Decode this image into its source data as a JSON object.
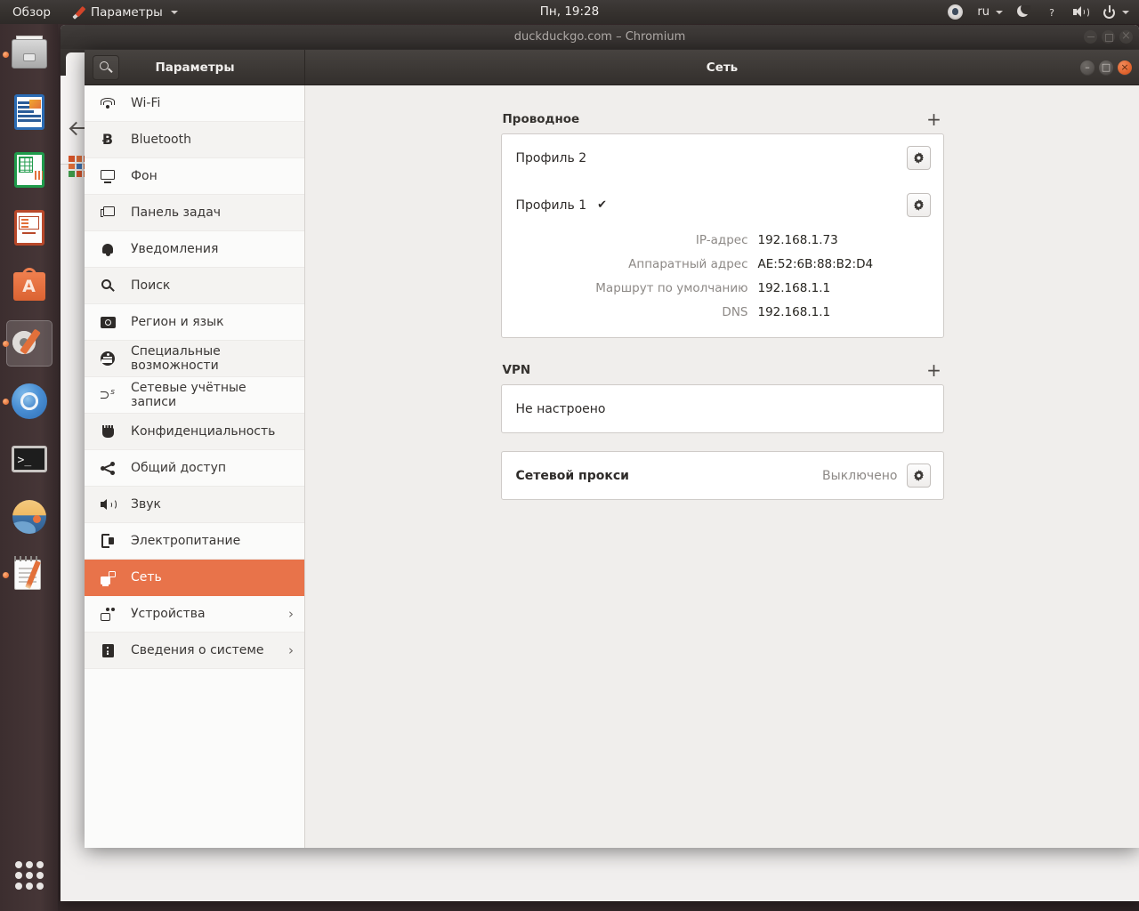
{
  "top_panel": {
    "overview_label": "Обзор",
    "app_menu_label": "Параметры",
    "app_menu_icon": "settings-wrench-icon",
    "clock": "Пн, 19:28",
    "tray": [
      {
        "name": "notification-indicator-icon",
        "icon": "circle-eye-icon",
        "label": ""
      },
      {
        "name": "keyboard-layout-indicator",
        "icon": "",
        "label": "ru"
      },
      {
        "name": "night-light-indicator-icon",
        "icon": "moon-icon",
        "label": ""
      },
      {
        "name": "help-indicator-icon",
        "icon": "keyboard-question-icon",
        "label": ""
      },
      {
        "name": "volume-indicator-icon",
        "icon": "speaker-icon",
        "label": ""
      },
      {
        "name": "system-menu-icon",
        "icon": "power-icon",
        "label": ""
      }
    ]
  },
  "launcher": {
    "items": [
      {
        "name": "launcher-item-files",
        "icon": "files-icon",
        "running": true,
        "active": false
      },
      {
        "name": "launcher-item-libreoffice-writer",
        "icon": "writer-icon",
        "running": false,
        "active": false
      },
      {
        "name": "launcher-item-libreoffice-calc",
        "icon": "calc-icon",
        "running": false,
        "active": false
      },
      {
        "name": "launcher-item-libreoffice-impress",
        "icon": "impress-icon",
        "running": false,
        "active": false
      },
      {
        "name": "launcher-item-ubuntu-software",
        "icon": "software-icon",
        "running": false,
        "active": false
      },
      {
        "name": "launcher-item-settings",
        "icon": "settings-icon",
        "running": true,
        "active": true
      },
      {
        "name": "launcher-item-chromium",
        "icon": "chromium-icon",
        "running": true,
        "active": false
      },
      {
        "name": "launcher-item-terminal",
        "icon": "terminal-icon",
        "running": false,
        "active": false
      },
      {
        "name": "launcher-item-photos",
        "icon": "photos-icon",
        "running": false,
        "active": false
      },
      {
        "name": "launcher-item-text-editor",
        "icon": "editor-icon",
        "running": true,
        "active": false
      }
    ],
    "app_grid_name": "show-applications-button"
  },
  "chromium_window": {
    "title": "duckduckgo.com – Chromium",
    "back_icon": "back-arrow-icon",
    "apps_icon": "apps-grid-icon",
    "controls": {
      "minimize": "–",
      "maximize": "□",
      "close": "×"
    }
  },
  "settings_window": {
    "sidebar_header_title": "Параметры",
    "search_icon": "search-icon",
    "main_header_title": "Сеть",
    "controls": {
      "minimize": "–",
      "maximize": "□",
      "close": "×"
    }
  },
  "sidebar": {
    "items": [
      {
        "label": "Wi-Fi",
        "icon": "wifi-icon",
        "name": "sidebar-item-wifi",
        "selected": false,
        "chevron": false
      },
      {
        "label": "Bluetooth",
        "icon": "bluetooth-icon",
        "name": "sidebar-item-bluetooth",
        "selected": false,
        "chevron": false
      },
      {
        "label": "Фон",
        "icon": "background-icon",
        "name": "sidebar-item-background",
        "selected": false,
        "chevron": false
      },
      {
        "label": "Панель задач",
        "icon": "dock-icon",
        "name": "sidebar-item-dock",
        "selected": false,
        "chevron": false
      },
      {
        "label": "Уведомления",
        "icon": "bell-icon",
        "name": "sidebar-item-notifications",
        "selected": false,
        "chevron": false
      },
      {
        "label": "Поиск",
        "icon": "magnifier-icon",
        "name": "sidebar-item-search",
        "selected": false,
        "chevron": false
      },
      {
        "label": "Регион и язык",
        "icon": "region-icon",
        "name": "sidebar-item-region-language",
        "selected": false,
        "chevron": false
      },
      {
        "label": "Специальные возможности",
        "icon": "accessibility-icon",
        "name": "sidebar-item-accessibility",
        "selected": false,
        "chevron": false
      },
      {
        "label": "Сетевые учётные записи",
        "icon": "online-accounts-icon",
        "name": "sidebar-item-online-accounts",
        "selected": false,
        "chevron": false
      },
      {
        "label": "Конфиденциальность",
        "icon": "hand-privacy-icon",
        "name": "sidebar-item-privacy",
        "selected": false,
        "chevron": false
      },
      {
        "label": "Общий доступ",
        "icon": "share-icon",
        "name": "sidebar-item-sharing",
        "selected": false,
        "chevron": false
      },
      {
        "label": "Звук",
        "icon": "speaker-icon",
        "name": "sidebar-item-sound",
        "selected": false,
        "chevron": false
      },
      {
        "label": "Электропитание",
        "icon": "power-plug-icon",
        "name": "sidebar-item-power",
        "selected": false,
        "chevron": false
      },
      {
        "label": "Сеть",
        "icon": "network-icon",
        "name": "sidebar-item-network",
        "selected": true,
        "chevron": false
      },
      {
        "label": "Устройства",
        "icon": "devices-icon",
        "name": "sidebar-item-devices",
        "selected": false,
        "chevron": true
      },
      {
        "label": "Сведения о системе",
        "icon": "info-icon",
        "name": "sidebar-item-details",
        "selected": false,
        "chevron": true
      }
    ],
    "chevron_glyph": "›"
  },
  "network_page": {
    "wired": {
      "title": "Проводное",
      "add_label": "+",
      "profiles": [
        {
          "name": "Профиль 2",
          "connected": false,
          "check_glyph": "",
          "settings_icon": "gear-icon",
          "details": []
        },
        {
          "name": "Профиль 1",
          "connected": true,
          "check_glyph": "✔",
          "settings_icon": "gear-icon",
          "details": [
            {
              "key": "IP-адрес",
              "value": "192.168.1.73"
            },
            {
              "key": "Аппаратный адрес",
              "value": "AE:52:6B:88:B2:D4"
            },
            {
              "key": "Маршрут по умолчанию",
              "value": "192.168.1.1"
            },
            {
              "key": "DNS",
              "value": "192.168.1.1"
            }
          ]
        }
      ]
    },
    "vpn": {
      "title": "VPN",
      "add_label": "+",
      "empty_label": "Не настроено"
    },
    "proxy": {
      "title": "Сетевой прокси",
      "status": "Выключено",
      "settings_icon": "gear-icon"
    }
  },
  "colors": {
    "accent_orange": "#E8734A",
    "panel_dark": "#36322F",
    "window_bg": "#F0EEEC",
    "sidebar_bg": "#FBFBFA",
    "card_white": "#FFFFFF"
  }
}
